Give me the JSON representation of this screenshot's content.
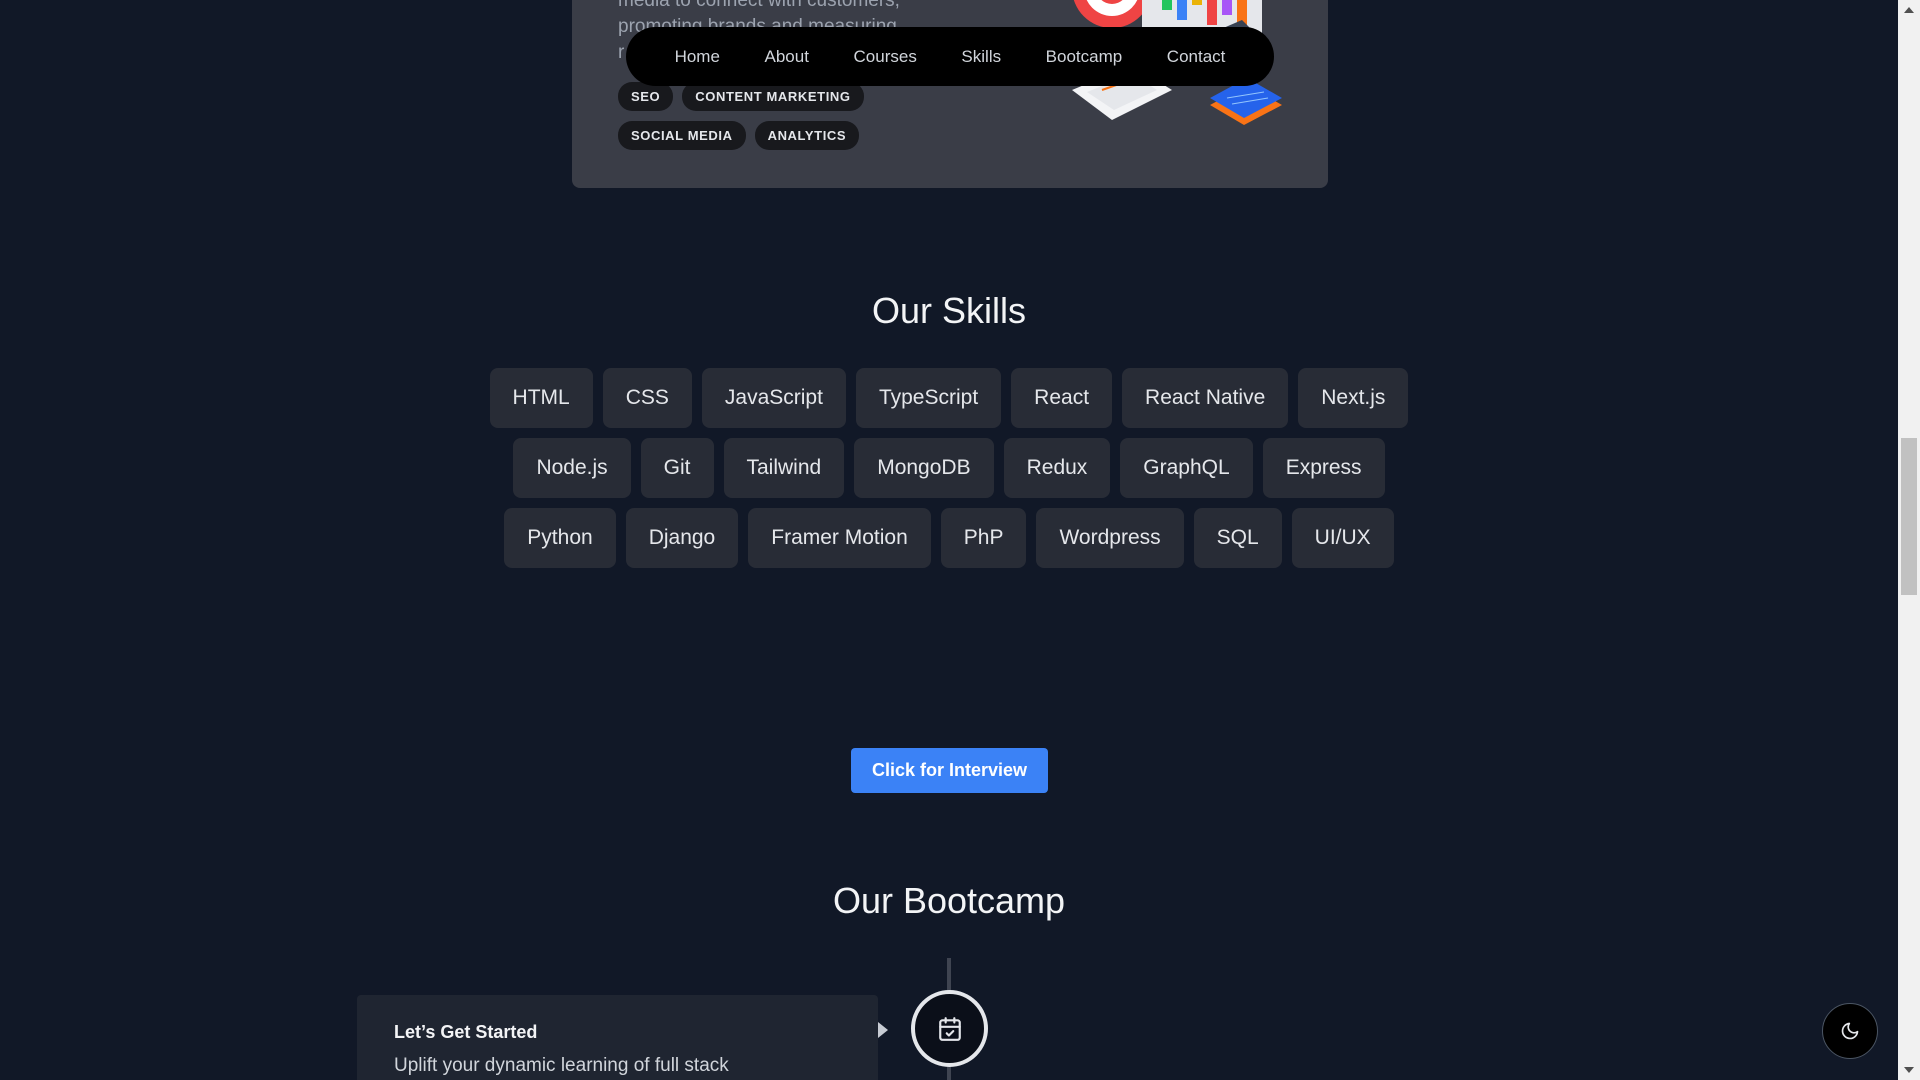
{
  "course": {
    "description_lines": [
      "media to connect with customers,",
      "promoting brands and measuring",
      "r"
    ],
    "tags": [
      [
        "SEO",
        "CONTENT MARKETING"
      ],
      [
        "SOCIAL MEDIA",
        "ANALYTICS"
      ]
    ]
  },
  "nav": {
    "items": [
      "Home",
      "About",
      "Courses",
      "Skills",
      "Bootcamp",
      "Contact"
    ]
  },
  "skills": {
    "title": "Our Skills",
    "rows": [
      [
        "HTML",
        "CSS",
        "JavaScript",
        "TypeScript",
        "React",
        "React Native",
        "Next.js"
      ],
      [
        "Node.js",
        "Git",
        "Tailwind",
        "MongoDB",
        "Redux",
        "GraphQL",
        "Express"
      ],
      [
        "Python",
        "Django",
        "Framer Motion",
        "PhP",
        "Wordpress",
        "SQL",
        "UI/UX"
      ]
    ]
  },
  "cta": {
    "label": "Click for Interview"
  },
  "bootcamp": {
    "title": "Our Bootcamp",
    "steps": [
      {
        "title": "Let’s Get Started",
        "text": "Uplift your dynamic learning of full stack",
        "icon": "calendar-check-icon"
      }
    ]
  },
  "theme_toggle": {
    "icon": "moon-icon"
  },
  "colors": {
    "background": "#111827",
    "card": "#3a3d47",
    "skill_chip": "#282c36",
    "accent": "#3b82f6",
    "navbar": "#000000"
  }
}
